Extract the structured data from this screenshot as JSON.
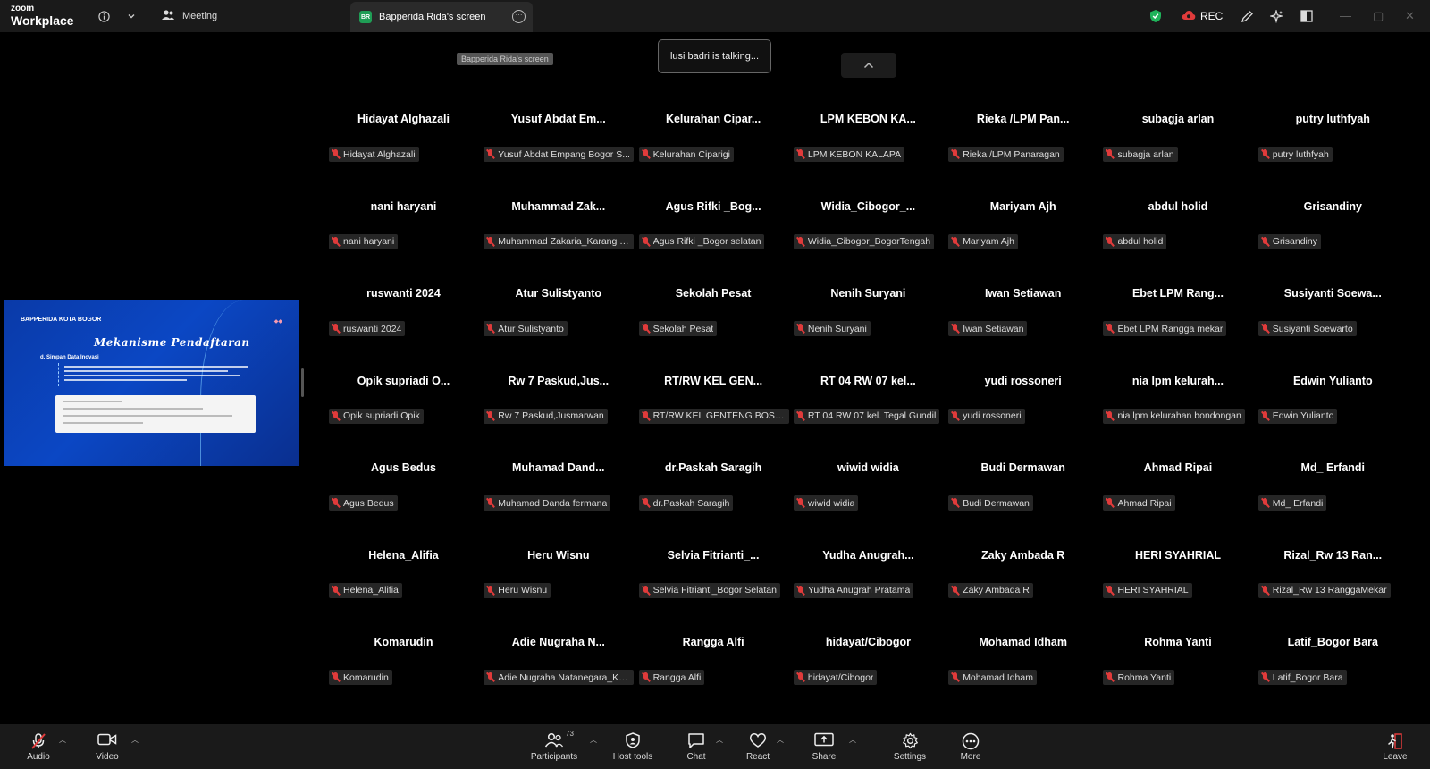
{
  "app": {
    "logo_small": "zoom",
    "logo_big": "Workplace",
    "meeting_tab": "Meeting",
    "screen_tab": "Bapperida Rida's screen",
    "screen_badge": "BR",
    "rec_label": "REC"
  },
  "stage": {
    "screen_label": "Bapperida Rida's screen",
    "talking": "lusi badri is talking..."
  },
  "shared_screen": {
    "logo_text": "BAPPERIDA KOTA BOGOR",
    "title": "Mekanisme Pendaftaran",
    "subtitle": "d. Simpan Data Inovasi"
  },
  "participants": [
    {
      "name": "Hidayat Alghazali",
      "label": "Hidayat Alghazali"
    },
    {
      "name": "Yusuf Abdat Em...",
      "label": "Yusuf Abdat Empang Bogor S..."
    },
    {
      "name": "Kelurahan Cipar...",
      "label": "Kelurahan Ciparigi"
    },
    {
      "name": "LPM KEBON KA...",
      "label": "LPM KEBON KALAPA"
    },
    {
      "name": "Rieka /LPM Pan...",
      "label": "Rieka /LPM Panaragan"
    },
    {
      "name": "subagja arlan",
      "label": "subagja arlan"
    },
    {
      "name": "putry luthfyah",
      "label": "putry luthfyah"
    },
    {
      "name": "nani haryani",
      "label": "nani haryani"
    },
    {
      "name": "Muhammad Zak...",
      "label": "Muhammad Zakaria_Karang T..."
    },
    {
      "name": "Agus Rifki _Bog...",
      "label": "Agus Rifki _Bogor selatan"
    },
    {
      "name": "Widia_Cibogor_...",
      "label": "Widia_Cibogor_BogorTengah"
    },
    {
      "name": "Mariyam Ajh",
      "label": "Mariyam Ajh"
    },
    {
      "name": "abdul holid",
      "label": "abdul holid"
    },
    {
      "name": "Grisandiny",
      "label": "Grisandiny"
    },
    {
      "name": "ruswanti 2024",
      "label": "ruswanti 2024"
    },
    {
      "name": "Atur Sulistyanto",
      "label": "Atur Sulistyanto"
    },
    {
      "name": "Sekolah Pesat",
      "label": "Sekolah Pesat"
    },
    {
      "name": "Nenih Suryani",
      "label": "Nenih Suryani"
    },
    {
      "name": "Iwan Setiawan",
      "label": "Iwan Setiawan"
    },
    {
      "name": "Ebet LPM Rang...",
      "label": "Ebet LPM Rangga mekar"
    },
    {
      "name": "Susiyanti Soewa...",
      "label": "Susiyanti Soewarto"
    },
    {
      "name": "Opik supriadi O...",
      "label": "Opik supriadi Opik"
    },
    {
      "name": "Rw 7 Paskud,Jus...",
      "label": "Rw 7 Paskud,Jusmarwan"
    },
    {
      "name": "RT/RW KEL GEN...",
      "label": "RT/RW KEL GENTENG BOSEL"
    },
    {
      "name": "RT 04 RW 07 kel...",
      "label": "RT 04 RW 07 kel. Tegal Gundil"
    },
    {
      "name": "yudi rossoneri",
      "label": "yudi rossoneri"
    },
    {
      "name": "nia lpm kelurah...",
      "label": "nia lpm kelurahan bondongan"
    },
    {
      "name": "Edwin Yulianto",
      "label": "Edwin Yulianto"
    },
    {
      "name": "Agus Bedus",
      "label": "Agus Bedus"
    },
    {
      "name": "Muhamad Dand...",
      "label": "Muhamad Danda fermana"
    },
    {
      "name": "dr.Paskah Saragih",
      "label": "dr.Paskah Saragih"
    },
    {
      "name": "wiwid widia",
      "label": "wiwid widia"
    },
    {
      "name": "Budi Dermawan",
      "label": "Budi Dermawan"
    },
    {
      "name": "Ahmad Ripai",
      "label": "Ahmad Ripai"
    },
    {
      "name": "Md_ Erfandi",
      "label": "Md_ Erfandi"
    },
    {
      "name": "Helena_Alifia",
      "label": "Helena_Alifia"
    },
    {
      "name": "Heru Wisnu",
      "label": "Heru Wisnu"
    },
    {
      "name": "Selvia Fitrianti_...",
      "label": "Selvia Fitrianti_Bogor Selatan"
    },
    {
      "name": "Yudha Anugrah...",
      "label": "Yudha Anugrah Pratama"
    },
    {
      "name": "Zaky Ambada R",
      "label": "Zaky Ambada R"
    },
    {
      "name": "HERI SYAHRIAL",
      "label": "HERI SYAHRIAL"
    },
    {
      "name": "Rizal_Rw 13 Ran...",
      "label": "Rizal_Rw 13 RanggaMekar"
    },
    {
      "name": "Komarudin",
      "label": "Komarudin"
    },
    {
      "name": "Adie Nugraha N...",
      "label": "Adie Nugraha Natanegara_Ka..."
    },
    {
      "name": "Rangga Alfi",
      "label": "Rangga Alfi"
    },
    {
      "name": "hidayat/Cibogor",
      "label": "hidayat/Cibogor"
    },
    {
      "name": "Mohamad Idham",
      "label": "Mohamad Idham"
    },
    {
      "name": "Rohma Yanti",
      "label": "Rohma Yanti"
    },
    {
      "name": "Latif_Bogor Bara",
      "label": "Latif_Bogor Bara"
    }
  ],
  "toolbar": {
    "audio": "Audio",
    "video": "Video",
    "participants": "Participants",
    "participants_count": "73",
    "host_tools": "Host tools",
    "chat": "Chat",
    "react": "React",
    "share": "Share",
    "settings": "Settings",
    "more": "More",
    "leave": "Leave"
  },
  "colors": {
    "accent_red": "#e03b3b",
    "shield_green": "#1fb35a",
    "badge_green": "#1f9d55"
  }
}
